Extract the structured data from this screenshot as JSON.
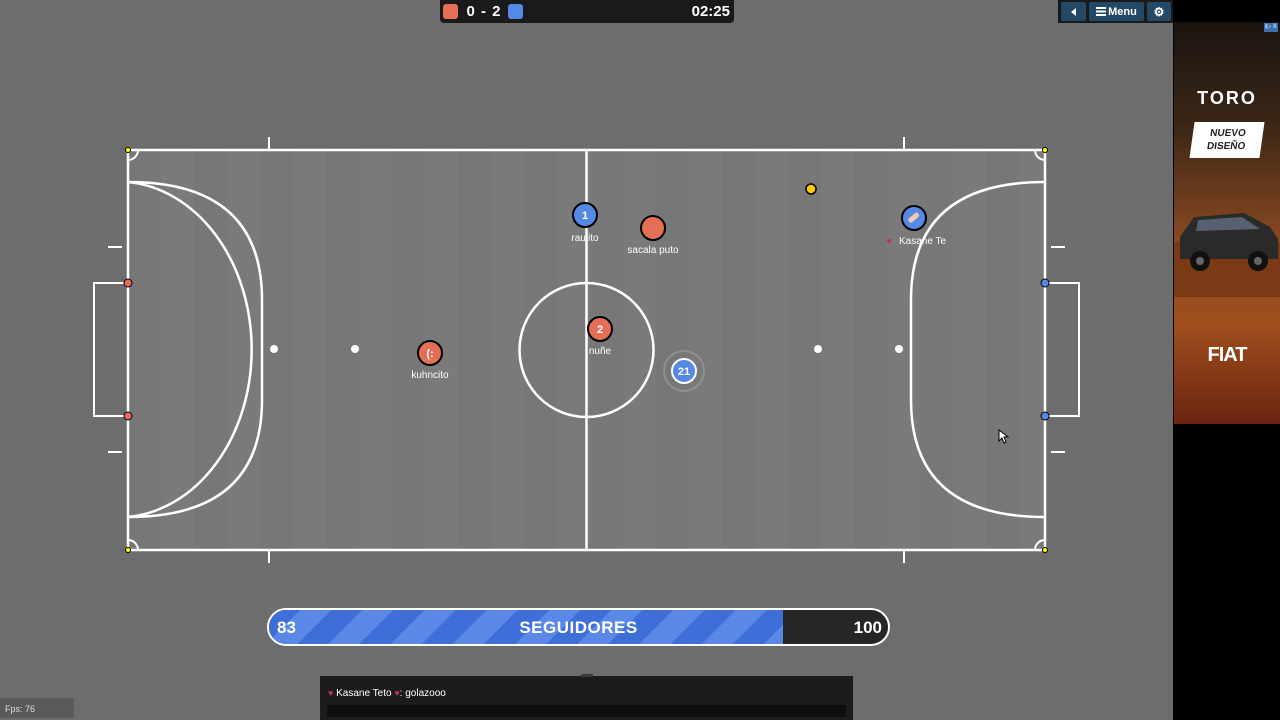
{
  "scoreboard": {
    "score": "0 - 2",
    "timer": "02:25",
    "red_color": "#e56e56",
    "blue_color": "#5689e5"
  },
  "top_menu": {
    "back_icon": "triangle-left-icon",
    "menu_label": "Menu",
    "menu_icon": "hamburger-icon",
    "settings_icon": "gear-icon"
  },
  "players": [
    {
      "name": "raulito",
      "team": "blue",
      "avatar": "1"
    },
    {
      "name": "sacala puto",
      "team": "red",
      "avatar": ""
    },
    {
      "name": "Kasane Te",
      "team": "blue",
      "avatar": "",
      "badge_icon": "heart-icon"
    },
    {
      "name": "nuñe",
      "team": "red",
      "avatar": "2"
    },
    {
      "name": "kuhncito",
      "team": "red",
      "avatar": "(:"
    },
    {
      "name": "",
      "team": "blue",
      "avatar": "21"
    }
  ],
  "progress": {
    "current": "83",
    "label": "SEGUIDORES",
    "max": "100",
    "fraction": 0.83
  },
  "chat": {
    "message_author": "Kasane Teto",
    "message_text": ": golazooo",
    "author_icon": "heart-icon"
  },
  "fps": "Fps: 76",
  "ad": {
    "brand": "TORO",
    "tagline_line1": "NUEVO",
    "tagline_line2": "DISEÑO",
    "logo": "FIAT",
    "choices_label": "i▷ X"
  }
}
